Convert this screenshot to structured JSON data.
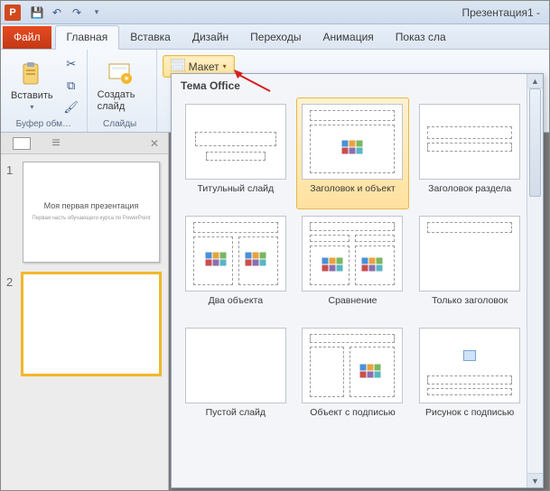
{
  "window": {
    "title": "Презентация1 -"
  },
  "qat": {
    "save": "save",
    "undo": "undo",
    "redo": "redo"
  },
  "tabs": {
    "file": "Файл",
    "home": "Главная",
    "insert": "Вставка",
    "design": "Дизайн",
    "transitions": "Переходы",
    "animations": "Анимация",
    "slideshow": "Показ сла"
  },
  "ribbon": {
    "clipboard": {
      "paste": "Вставить",
      "group_label": "Буфер обм…"
    },
    "slides": {
      "new_slide": "Создать слайд",
      "layout": "Макет",
      "group_label": "Слайды"
    }
  },
  "slide_panel": {
    "slides": [
      {
        "num": "1",
        "title": "Моя первая презентация",
        "subtitle": "Первая часть обучающего курса по PowerPoint",
        "selected": false
      },
      {
        "num": "2",
        "title": "",
        "subtitle": "",
        "selected": true
      }
    ]
  },
  "layout_gallery": {
    "header": "Тема Office",
    "items": [
      {
        "key": "title",
        "label": "Титульный слайд"
      },
      {
        "key": "titlecontent",
        "label": "Заголовок и объект",
        "selected": true
      },
      {
        "key": "section",
        "label": "Заголовок раздела"
      },
      {
        "key": "two",
        "label": "Два объекта"
      },
      {
        "key": "compare",
        "label": "Сравнение"
      },
      {
        "key": "onlytitle",
        "label": "Только заголовок"
      },
      {
        "key": "blank",
        "label": "Пустой слайд"
      },
      {
        "key": "objcap",
        "label": "Объект с подписью"
      },
      {
        "key": "piccap",
        "label": "Рисунок с подписью"
      }
    ]
  }
}
